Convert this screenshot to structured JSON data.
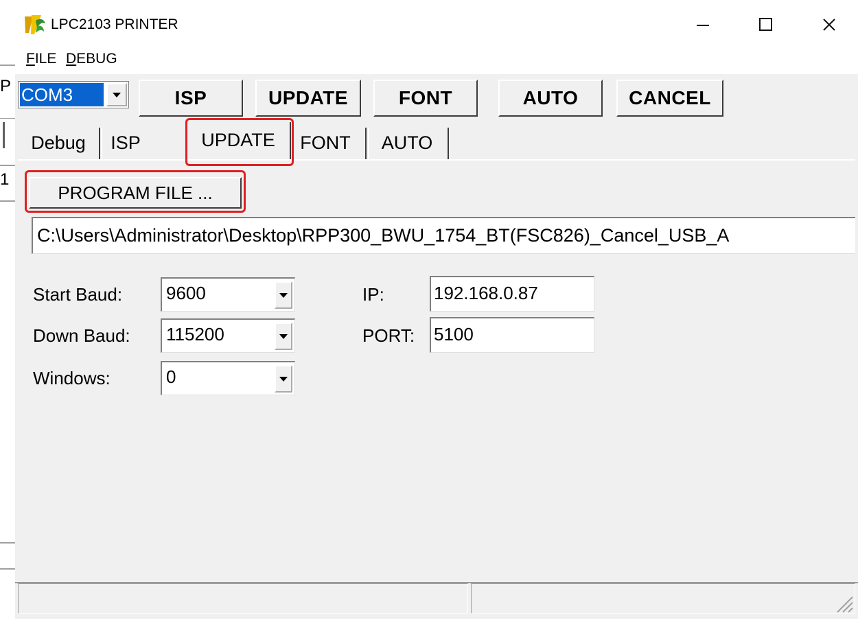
{
  "window": {
    "title": "LPC2103 PRINTER",
    "controls": [
      "minimize-icon",
      "maximize-icon",
      "close-icon"
    ]
  },
  "menu": {
    "items": [
      {
        "label": "FILE",
        "accel": "F",
        "rest": "ILE"
      },
      {
        "label": "DEBUG",
        "accel": "D",
        "rest": "EBUG"
      }
    ]
  },
  "toolbar": {
    "port": "COM3",
    "buttons": [
      "ISP",
      "UPDATE",
      "FONT",
      "AUTO",
      "CANCEL"
    ]
  },
  "tabs": {
    "items": [
      "Debug",
      "ISP",
      "UPDATE",
      "FONT",
      "AUTO"
    ],
    "active": "UPDATE"
  },
  "update": {
    "program_file_button": "PROGRAM FILE ...",
    "file_path": "C:\\Users\\Administrator\\Desktop\\RPP300_BWU_1754_BT(FSC826)_Cancel_USB_A",
    "start_baud_label": "Start  Baud:",
    "start_baud": "9600",
    "down_baud_label": "Down Baud:",
    "down_baud": "115200",
    "windows_label": "Windows:",
    "windows": "0",
    "ip_label": "IP:",
    "ip": "192.168.0.87",
    "port_label": "PORT:",
    "port": "5100"
  },
  "background": {
    "glyphs": [
      "P",
      "1"
    ]
  },
  "colors": {
    "highlight": "#e02020",
    "selection": "#0a64cf",
    "face": "#f0f0f0"
  }
}
